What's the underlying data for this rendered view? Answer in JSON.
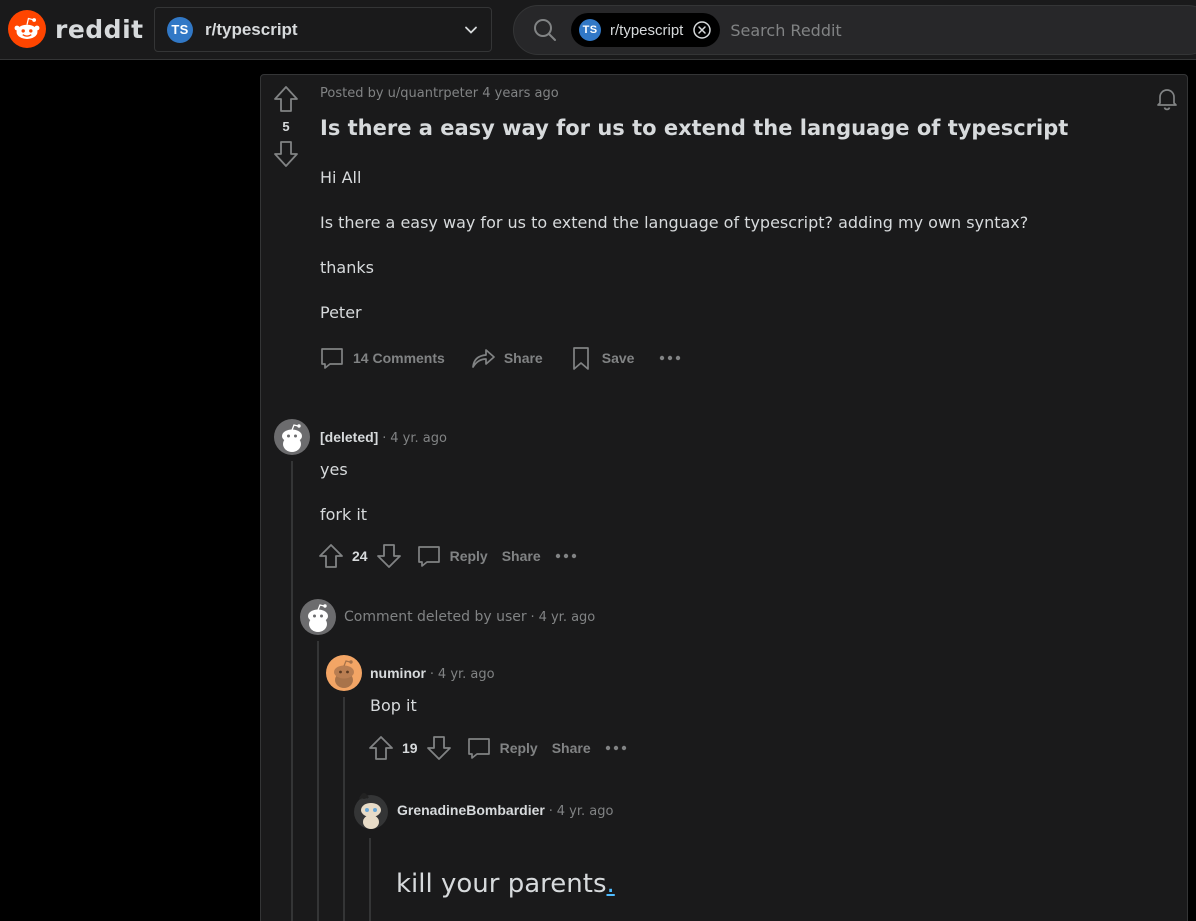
{
  "header": {
    "wordmark": "reddit",
    "community": {
      "badge": "TS",
      "name": "r/typescript"
    },
    "search": {
      "chip_badge": "TS",
      "chip_label": "r/typescript",
      "placeholder": "Search Reddit"
    }
  },
  "post": {
    "score": "5",
    "meta": "Posted by u/quantrpeter 4 years ago",
    "title": "Is there a easy way for us to extend the language of typescript",
    "body": [
      "Hi All",
      "Is there a easy way for us to extend the language of typescript? adding my own syntax?",
      "thanks",
      "Peter"
    ],
    "actions": {
      "comments": "14 Comments",
      "share": "Share",
      "save": "Save"
    }
  },
  "comments": [
    {
      "author": "[deleted]",
      "sep": "·",
      "time": "4 yr. ago",
      "lines": [
        "yes",
        "fork it"
      ],
      "score": "24",
      "reply": "Reply",
      "share": "Share"
    },
    {
      "deleted_text": "Comment deleted by user",
      "sep": "·",
      "time": "4 yr. ago"
    },
    {
      "author": "numinor",
      "sep": "·",
      "time": "4 yr. ago",
      "lines": [
        "Bop it"
      ],
      "score": "19",
      "reply": "Reply",
      "share": "Share"
    },
    {
      "author": "GrenadineBombardier",
      "sep": "·",
      "time": "4 yr. ago",
      "text": "kill your parents",
      "link": "."
    }
  ],
  "colors": {
    "background": "#000000",
    "card": "#1a1a1b",
    "border": "#343536",
    "text": "#d7dadc",
    "muted": "#818384",
    "brand": "#ff4500",
    "ts_blue": "#3178c6",
    "link": "#4fbcff"
  }
}
